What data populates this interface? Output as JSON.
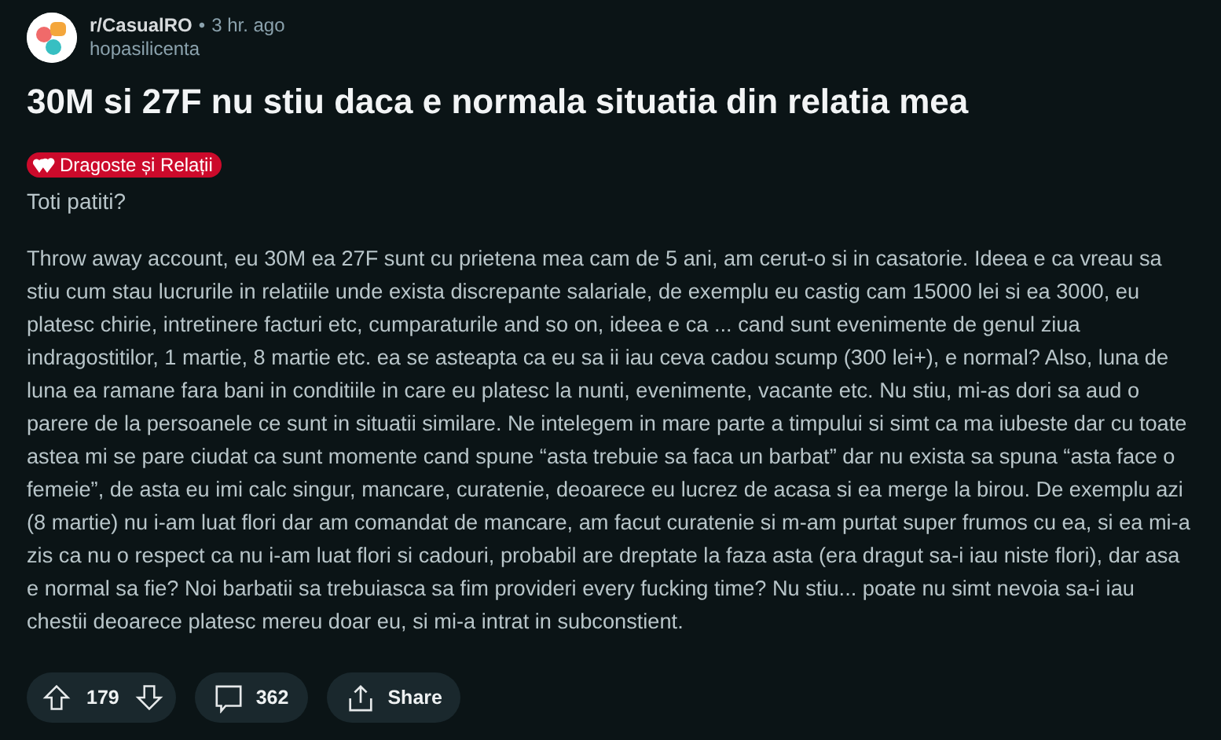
{
  "post": {
    "subreddit": "r/CasualRO",
    "separator": "•",
    "time": "3 hr. ago",
    "author": "hopasilicenta",
    "title": "30M si 27F nu stiu daca e normala situatia din relatia mea",
    "flair": {
      "label": "Dragoste și Relații",
      "color": "#cc0a2b"
    },
    "subtitle": "Toti patiti?",
    "body": "Throw away account, eu 30M ea 27F sunt cu prietena mea cam de 5 ani, am cerut-o si in casatorie. Ideea e ca vreau sa stiu cum stau lucrurile in relatiile unde exista discrepante salariale, de exemplu eu castig cam 15000 lei si ea 3000, eu platesc chirie, intretinere facturi etc, cumparaturile and so on, ideea e ca ... cand sunt evenimente de genul ziua indragostitilor, 1 martie, 8 martie etc. ea se asteapta ca eu sa ii iau ceva cadou scump (300 lei+), e normal? Also, luna de luna ea ramane fara bani in conditiile in care eu platesc la nunti, evenimente, vacante etc. Nu stiu, mi-as dori sa aud o parere de la persoanele ce sunt in situatii similare. Ne intelegem in mare parte a timpului si simt ca ma iubeste dar cu toate astea mi se pare ciudat ca sunt momente cand spune “asta trebuie sa faca un barbat” dar nu exista sa spuna “asta face o femeie”, de asta eu imi calc singur, mancare, curatenie, deoarece eu lucrez de acasa si ea merge la birou. De exemplu azi (8 martie) nu i-am luat flori dar am comandat de mancare, am facut curatenie si m-am purtat super frumos cu ea, si ea mi-a zis ca nu o respect ca nu i-am luat flori si cadouri, probabil are dreptate la faza asta (era dragut sa-i iau niste flori), dar asa e normal sa fie? Noi barbatii sa trebuiasca sa fim provideri every fucking time? Nu stiu... poate nu simt nevoia sa-i iau chestii deoarece platesc mereu doar eu, si mi-a intrat in subconstient."
  },
  "actions": [
    {
      "kind": "vote",
      "count": "179"
    },
    {
      "kind": "comments",
      "count": "362"
    },
    {
      "kind": "share",
      "label": "Share"
    }
  ]
}
